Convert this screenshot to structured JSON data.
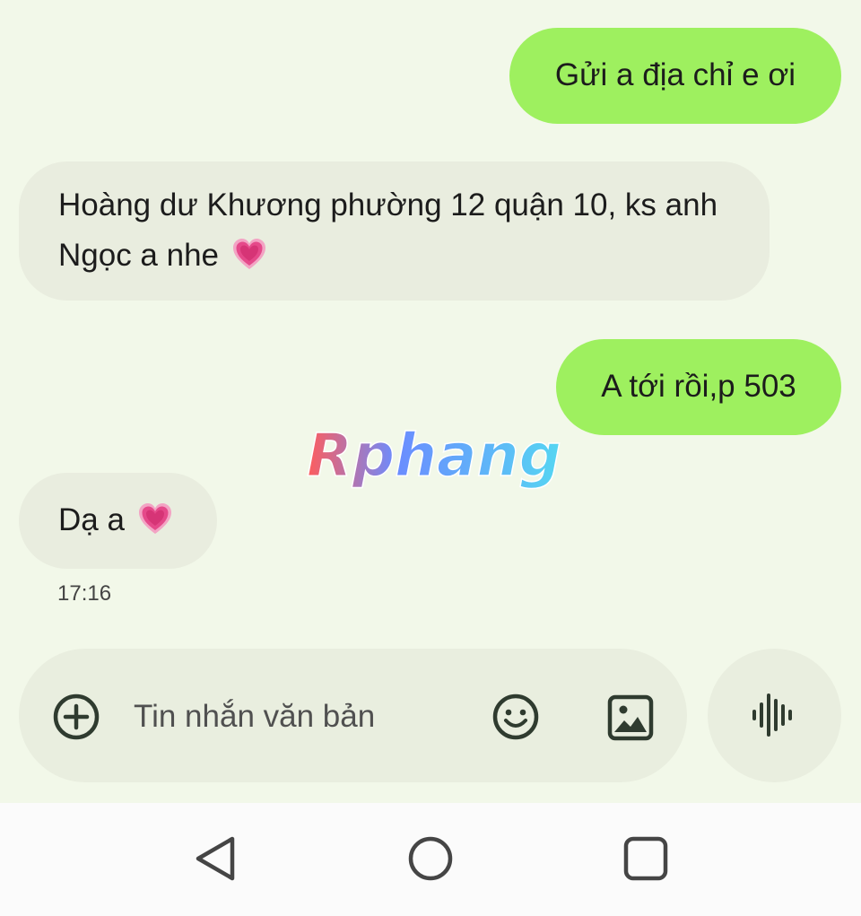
{
  "messages": [
    {
      "direction": "outgoing",
      "text": "Gửi a địa chỉ e ơi"
    },
    {
      "direction": "incoming",
      "text_line1": "Hoàng dư Khương phường 12 quận 10, ks anh",
      "text_line2": "Ngọc a nhe",
      "emoji": "pink-heart-icon"
    },
    {
      "direction": "outgoing",
      "text": "A tới rồi,p 503"
    },
    {
      "direction": "incoming",
      "text": "Dạ a",
      "emoji": "pink-heart-icon"
    }
  ],
  "timestamp": "17:16",
  "watermark": "Rphang",
  "composer": {
    "placeholder": "Tin nhắn văn bản",
    "icons": [
      "add-circle-icon",
      "emoji-icon",
      "gallery-icon",
      "voice-waveform-icon"
    ]
  },
  "navbar": {
    "icons": [
      "back-triangle-icon",
      "home-circle-icon",
      "recents-square-icon"
    ]
  },
  "colors": {
    "background": "#f2f8e9",
    "outgoing_bubble": "#9ef05f",
    "incoming_bubble": "#e9eddf",
    "heart": "#e5498a"
  }
}
